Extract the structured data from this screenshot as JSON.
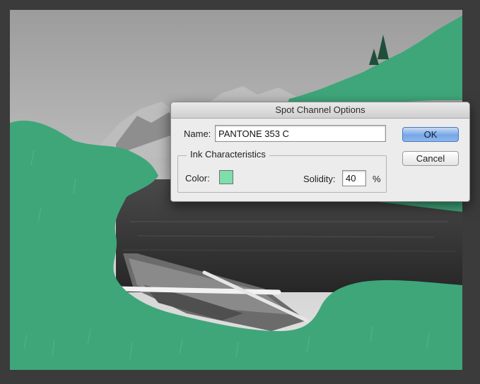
{
  "dialog": {
    "title": "Spot Channel Options",
    "name_label": "Name:",
    "name_value": "PANTONE 353 C",
    "ink_group_title": "Ink Characteristics",
    "color_label": "Color:",
    "color_swatch": "#7fdfaa",
    "solidity_label": "Solidity:",
    "solidity_value": "40",
    "solidity_unit": "%",
    "ok_label": "OK",
    "cancel_label": "Cancel"
  },
  "colors": {
    "spot_overlay": "#3fa67a",
    "canvas_background": "#3b3b3b"
  }
}
